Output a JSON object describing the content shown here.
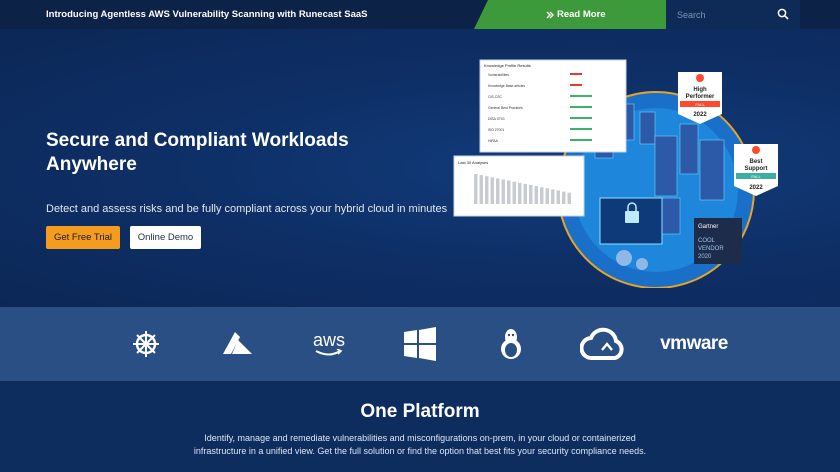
{
  "topbar": {
    "announcement": "Introducing Agentless AWS Vulnerability Scanning with Runecast SaaS",
    "read_more": "Read More",
    "read_more_icon": "double-chevron-right-icon",
    "search_placeholder": "Search"
  },
  "hero": {
    "title": "Secure and Compliant Workloads Anywhere",
    "subtitle": "Detect and assess risks and be fully compliant across your hybrid cloud in minutes",
    "primary_button": "Get Free Trial",
    "secondary_button": "Online Demo"
  },
  "illustration": {
    "panel_title": "Knowledge Profile Results",
    "panel_rows": [
      "Vulnerabilities",
      "Knowledge Base articles",
      "CIS-CSC",
      "General Best Practices",
      "DISA STIG",
      "ISO 27001",
      "HIPAA"
    ],
    "chart_title": "Last 30 Analyses",
    "badge1": {
      "label1": "High",
      "label2": "Performer",
      "season": "FALL",
      "year": "2022"
    },
    "badge2": {
      "label1": "Best",
      "label2": "Support",
      "season": "FALL",
      "year": "2022"
    },
    "gartner": {
      "brand": "Gartner",
      "line1": "COOL",
      "line2": "VENDOR",
      "year": "2020"
    },
    "colors": {
      "badge_red": "#ff492c",
      "badge_green": "#3ab0a0",
      "globe": "#1e8ee0"
    }
  },
  "platforms": [
    {
      "name": "Kubernetes",
      "icon": "kubernetes-icon"
    },
    {
      "name": "Azure",
      "icon": "azure-icon"
    },
    {
      "name": "AWS",
      "icon": "aws-icon"
    },
    {
      "name": "Windows",
      "icon": "windows-icon"
    },
    {
      "name": "Linux",
      "icon": "linux-icon"
    },
    {
      "name": "Cloud",
      "icon": "cloud-icon"
    },
    {
      "name": "VMware",
      "icon": "vmware-icon"
    }
  ],
  "logos": {
    "aws_text": "aws",
    "vmware_text": "vmware"
  },
  "platform_section": {
    "title": "One Platform",
    "text": "Identify, manage and remediate vulnerabilities and misconfigurations on-prem, in your cloud or containerized infrastructure in a unified view. Get the full solution or find the option that best fits your security compliance needs."
  },
  "colors": {
    "navy": "#0d2d5e",
    "green": "#3d9a3a",
    "orange": "#f39c1f",
    "strip": "#2a4f84"
  }
}
